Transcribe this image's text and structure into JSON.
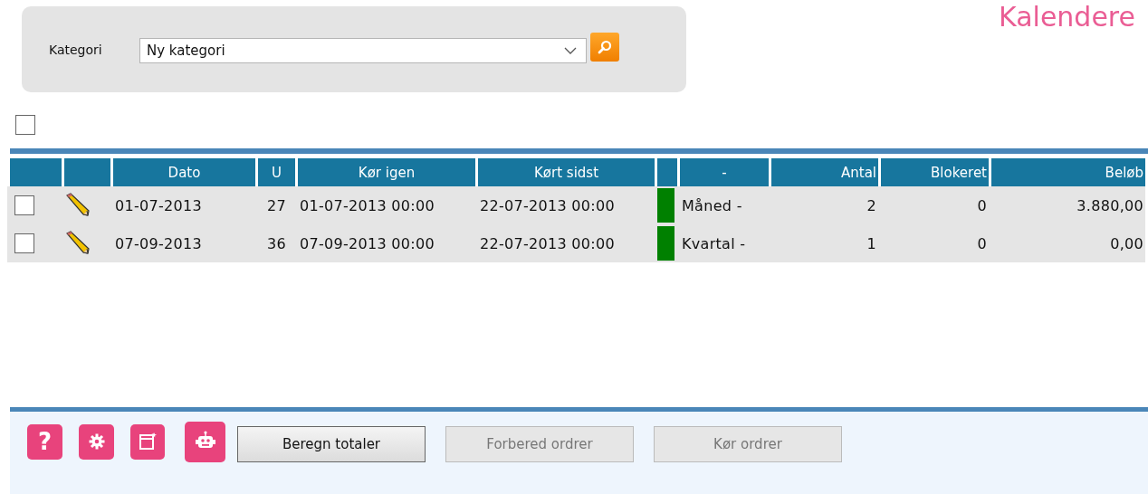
{
  "page_title": "Kalendere",
  "filter": {
    "label": "Kategori",
    "value": "Ny kategori"
  },
  "select_all": {
    "checked": false
  },
  "table": {
    "columns": [
      "",
      "",
      "Dato",
      "U",
      "Kør igen",
      "Kørt sidst",
      "",
      "-",
      "Antal",
      "Blokeret",
      "Beløb"
    ],
    "rows": [
      {
        "checked": false,
        "dato": "01-07-2013",
        "u": "27",
        "kor_igen": "01-07-2013 00:00",
        "kort_sidst": "22-07-2013 00:00",
        "color": "#008000",
        "type": "Måned -",
        "antal": "2",
        "blokeret": "0",
        "belob": "3.880,00"
      },
      {
        "checked": false,
        "dato": "07-09-2013",
        "u": "36",
        "kor_igen": "07-09-2013 00:00",
        "kort_sidst": "22-07-2013 00:00",
        "color": "#008000",
        "type": "Kvartal -",
        "antal": "1",
        "blokeret": "0",
        "belob": "0,00"
      }
    ]
  },
  "toolbar": {
    "icons": [
      {
        "kind": "help",
        "glyph": "?"
      },
      {
        "kind": "settings"
      },
      {
        "kind": "note"
      },
      {
        "kind": "robot"
      }
    ],
    "buttons": [
      {
        "label": "Beregn totaler",
        "disabled": false
      },
      {
        "label": "Forbered ordrer",
        "disabled": true
      },
      {
        "label": "Kør ordrer",
        "disabled": true
      }
    ]
  }
}
